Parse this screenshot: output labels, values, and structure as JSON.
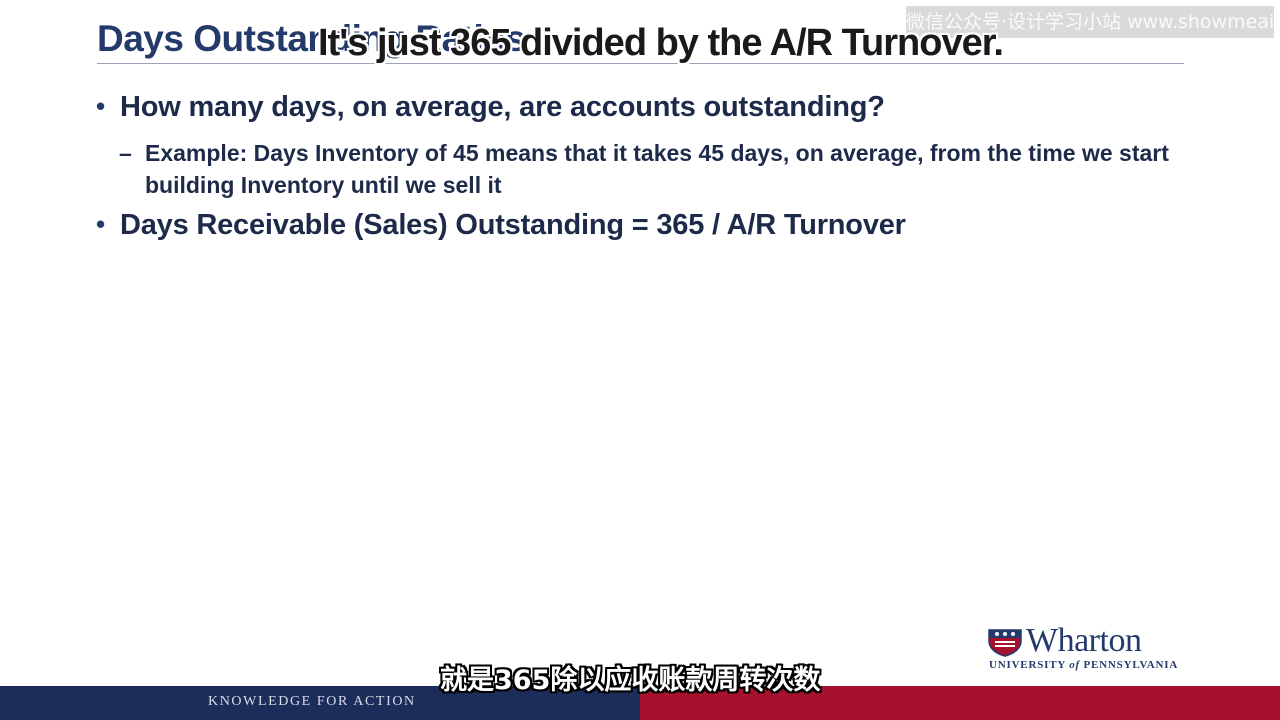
{
  "slide": {
    "title": "Days Outstanding Ratios",
    "bullets": [
      {
        "text": "How many days, on average, are accounts outstanding?",
        "sub": [
          "Example: Days Inventory of 45 means that it takes 45 days, on average, from the time we start building Inventory until we sell it"
        ]
      },
      {
        "text": "Days Receivable (Sales) Outstanding = 365 / A/R Turnover"
      }
    ],
    "bullet_glyph": "•",
    "dash_glyph": "–"
  },
  "subtitles": {
    "english": "It's just 365 divided by the A/R Turnover.",
    "chinese": "就是365除以应收账款周转次数"
  },
  "watermark": {
    "text": "微信公众号·设计学习小站 www.showmeai.tech"
  },
  "logo": {
    "name": "Wharton",
    "subtitle_pre": "UNIVERSITY ",
    "subtitle_of": "of",
    "subtitle_post": " PENNSYLVANIA",
    "icon": "penn-shield-icon"
  },
  "footer": {
    "tagline": "KNOWLEDGE FOR ACTION",
    "colors": {
      "blue": "#1c2c5b",
      "red": "#a6122d"
    }
  },
  "colors": {
    "title": "#243a6b",
    "body_text": "#1e2a4a",
    "rule": "#9aa3b5"
  }
}
